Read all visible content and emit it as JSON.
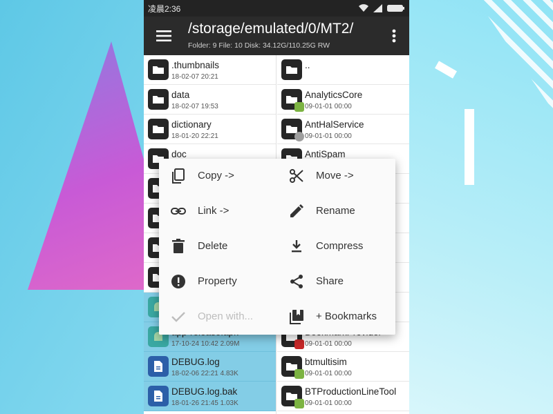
{
  "status_bar": {
    "time": "凌晨2:36"
  },
  "app_bar": {
    "path": "/storage/emulated/0/MT2/",
    "info": "Folder: 9  File: 10  Disk: 34.12G/110.25G  RW"
  },
  "left_pane": {
    "items": [
      {
        "name": ".thumbnails",
        "meta": "18-02-07 20:21",
        "icon": "folder-icon"
      },
      {
        "name": "data",
        "meta": "18-02-07 19:53",
        "icon": "folder-icon"
      },
      {
        "name": "dictionary",
        "meta": "18-01-20 22:21",
        "icon": "folder-icon"
      },
      {
        "name": "doc",
        "meta": "",
        "icon": "folder-icon"
      },
      {
        "name": "",
        "meta": "",
        "icon": "folder-icon"
      },
      {
        "name": "",
        "meta": "",
        "icon": "folder-icon"
      },
      {
        "name": "",
        "meta": "",
        "icon": "folder-icon"
      },
      {
        "name": "",
        "meta": "",
        "icon": "folder-icon"
      },
      {
        "name": "",
        "meta": "",
        "icon": "apk-icon"
      },
      {
        "name": "app-release.apk",
        "meta": "17-10-24 10:42  2.09M",
        "icon": "apk-icon"
      },
      {
        "name": "DEBUG.log",
        "meta": "18-02-06 22:21  4.83K",
        "icon": "document-icon"
      },
      {
        "name": "DEBUG.log.bak",
        "meta": "18-01-26 21:45  1.03K",
        "icon": "document-icon"
      }
    ]
  },
  "right_pane": {
    "items": [
      {
        "name": "..",
        "meta": "",
        "badge": ""
      },
      {
        "name": "AnalyticsCore",
        "meta": "09-01-01 00:00",
        "badge": "android"
      },
      {
        "name": "AntHalService",
        "meta": "09-01-01 00:00",
        "badge": "gear"
      },
      {
        "name": "AntiSpam",
        "meta": "",
        "badge": "android"
      },
      {
        "name": "",
        "meta": "",
        "badge": ""
      },
      {
        "name": "",
        "meta": "",
        "badge": ""
      },
      {
        "name": "",
        "meta": "",
        "badge": ""
      },
      {
        "name": "",
        "meta": "",
        "badge": ""
      },
      {
        "name": "",
        "meta": "",
        "badge": ""
      },
      {
        "name": "BookmarkProvider",
        "meta": "09-01-01 00:00",
        "badge": "book"
      },
      {
        "name": "btmultisim",
        "meta": "09-01-01 00:00",
        "badge": "android"
      },
      {
        "name": "BTProductionLineTool",
        "meta": "09-01-01 00:00",
        "badge": "android"
      }
    ]
  },
  "context_menu": {
    "items": [
      {
        "label": "Copy ->",
        "icon": "copy-icon"
      },
      {
        "label": "Move ->",
        "icon": "scissors-icon"
      },
      {
        "label": "Link ->",
        "icon": "link-icon"
      },
      {
        "label": "Rename",
        "icon": "pencil-icon"
      },
      {
        "label": "Delete",
        "icon": "trash-icon"
      },
      {
        "label": "Compress",
        "icon": "download-icon"
      },
      {
        "label": "Property",
        "icon": "info-icon"
      },
      {
        "label": "Share",
        "icon": "share-icon"
      },
      {
        "label": "Open with...",
        "icon": "check-icon",
        "disabled": true
      },
      {
        "label": "+ Bookmarks",
        "icon": "bookmarks-icon"
      }
    ]
  },
  "colors": {
    "selected_row": "#83cde6",
    "app_bar": "#2b2b2b",
    "status_bar": "#232323"
  }
}
